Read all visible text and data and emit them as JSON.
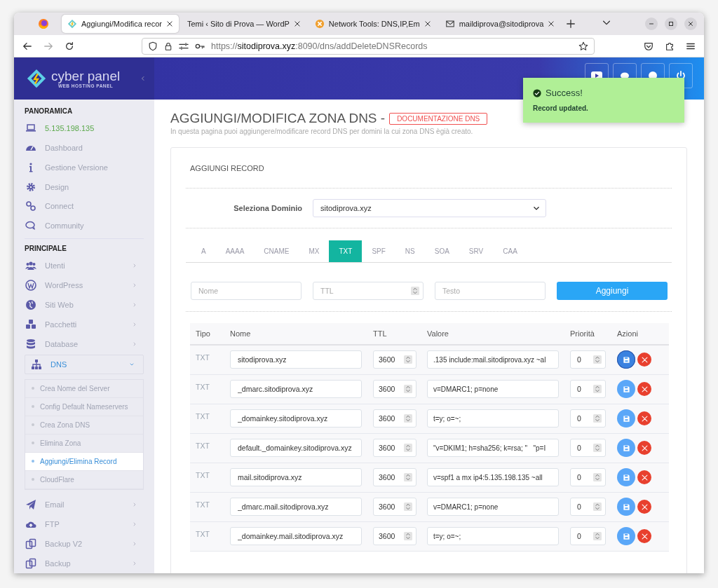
{
  "browser": {
    "tabs": [
      {
        "title": "Aggiungi/Modifica recor",
        "selected": true
      },
      {
        "title": "Temi ‹ Sito di Prova — WordP",
        "selected": false
      },
      {
        "title": "Network Tools: DNS,IP,Em",
        "selected": false
      },
      {
        "title": "maildiprova@sitodiprova",
        "selected": false
      }
    ],
    "address": {
      "scheme": "https://",
      "host": "sitodiprova.xyz",
      "path": ":8090/dns/addDeleteDNSRecords"
    }
  },
  "sidebar": {
    "logo": {
      "name": "cyber panel",
      "tagline": "WEB HOSTING PANEL"
    },
    "sections": [
      {
        "title": "PANORAMICA",
        "items": [
          {
            "kind": "ip",
            "label": "5.135.198.135"
          },
          {
            "kind": "link",
            "label": "Dashboard"
          },
          {
            "kind": "link",
            "label": "Gestione Versione"
          },
          {
            "kind": "link",
            "label": "Design"
          },
          {
            "kind": "link",
            "label": "Connect"
          },
          {
            "kind": "link",
            "label": "Community"
          }
        ]
      },
      {
        "title": "PRINCIPALE",
        "items": [
          {
            "kind": "menu",
            "label": "Utenti",
            "expanded": false
          },
          {
            "kind": "menu",
            "label": "WordPress",
            "expanded": false
          },
          {
            "kind": "menu",
            "label": "Siti Web",
            "expanded": false
          },
          {
            "kind": "menu",
            "label": "Pacchetti",
            "expanded": false
          },
          {
            "kind": "menu",
            "label": "Database",
            "expanded": false
          },
          {
            "kind": "menu",
            "label": "DNS",
            "expanded": true,
            "children": [
              {
                "label": "Crea Nome del Server",
                "selected": false
              },
              {
                "label": "Config Default Nameservers",
                "selected": false
              },
              {
                "label": "Crea Zona DNS",
                "selected": false
              },
              {
                "label": "Elimina Zona",
                "selected": false
              },
              {
                "label": "Aggiungi/Elimina Record",
                "selected": true
              },
              {
                "label": "CloudFlare",
                "selected": false
              }
            ]
          },
          {
            "kind": "menu",
            "label": "Email",
            "expanded": false
          },
          {
            "kind": "menu",
            "label": "FTP",
            "expanded": false
          },
          {
            "kind": "menu",
            "label": "Backup V2",
            "expanded": false
          },
          {
            "kind": "menu",
            "label": "Backup",
            "expanded": false
          }
        ]
      }
    ]
  },
  "toast": {
    "title": "Success!",
    "message": "Record updated."
  },
  "page": {
    "title": "AGGIUNGI/MODIFICA ZONA DNS -",
    "doc_link": "DOCUMENTAZIONE DNS",
    "subtitle": "In questa pagina puoi aggiungere/modificare record DNS per domini la cui zona DNS ègià creato."
  },
  "card": {
    "title": "AGGIUNGI RECORD",
    "domain_label": "Seleziona Dominio",
    "domain_value": "sitodiprova.xyz",
    "record_tabs": [
      {
        "label": "A",
        "selected": false
      },
      {
        "label": "AAAA",
        "selected": false
      },
      {
        "label": "CNAME",
        "selected": false
      },
      {
        "label": "MX",
        "selected": false
      },
      {
        "label": "TXT",
        "selected": true
      },
      {
        "label": "SPF",
        "selected": false
      },
      {
        "label": "NS",
        "selected": false
      },
      {
        "label": "SOA",
        "selected": false
      },
      {
        "label": "SRV",
        "selected": false
      },
      {
        "label": "CAA",
        "selected": false
      }
    ],
    "add_form": {
      "name_placeholder": "Nome",
      "ttl_placeholder": "TTL",
      "text_placeholder": "Testo",
      "button": "Aggiungi"
    },
    "table": {
      "columns": [
        "Tipo",
        "Nome",
        "TTL",
        "Valore",
        "Priorità",
        "Azioni"
      ],
      "rows": [
        {
          "type": "TXT",
          "name": "sitodiprova.xyz",
          "ttl": "3600",
          "value": ".135 include:mail.sitodiprova.xyz ~al",
          "priority": "0",
          "focused": true
        },
        {
          "type": "TXT",
          "name": "_dmarc.sitodiprova.xyz",
          "ttl": "3600",
          "value": "v=DMARC1; p=none",
          "priority": "0",
          "focused": false
        },
        {
          "type": "TXT",
          "name": "_domainkey.sitodiprova.xyz",
          "ttl": "3600",
          "value": "t=y; o=~;",
          "priority": "0",
          "focused": false
        },
        {
          "type": "TXT",
          "name": "default._domainkey.sitodiprova.xyz",
          "ttl": "3600",
          "value": "\"v=DKIM1; h=sha256; k=rsa; \"   \"p=I",
          "priority": "0",
          "focused": false
        },
        {
          "type": "TXT",
          "name": "mail.sitodiprova.xyz",
          "ttl": "3600",
          "value": "v=spf1 a mx ip4:5.135.198.135 ~all",
          "priority": "0",
          "focused": false
        },
        {
          "type": "TXT",
          "name": "_dmarc.mail.sitodiprova.xyz",
          "ttl": "3600",
          "value": "v=DMARC1; p=none",
          "priority": "0",
          "focused": false
        },
        {
          "type": "TXT",
          "name": "_domainkey.mail.sitodiprova.xyz",
          "ttl": "3600",
          "value": "t=y; o=~;",
          "priority": "0",
          "focused": false
        }
      ]
    }
  }
}
